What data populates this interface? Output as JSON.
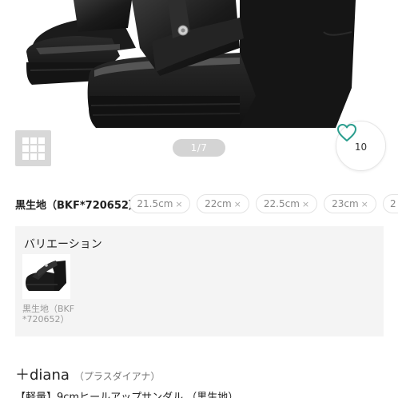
{
  "gallery": {
    "pager": "1/7",
    "favorite_count": "10"
  },
  "sizes": {
    "color_label": "黒生地（BKF*720652）",
    "options": [
      {
        "label": "21.5cm",
        "mark": "×"
      },
      {
        "label": "22cm",
        "mark": "×"
      },
      {
        "label": "22.5cm",
        "mark": "×"
      },
      {
        "label": "23cm",
        "mark": "×"
      },
      {
        "label": "2",
        "mark": ""
      }
    ]
  },
  "variation": {
    "heading": "バリエーション",
    "items": [
      {
        "caption": "黒生地（BKF*720652）"
      }
    ]
  },
  "product": {
    "brand": "＋diana",
    "brand_kana": "（プラスダイアナ）",
    "title": "【軽量】9cmヒールアップサンダル （黒生地）"
  },
  "icons": [
    "grid-icon",
    "heart-icon"
  ],
  "colors": {
    "accent": "#2b9e8e",
    "pager_bg": "#d4d4d4",
    "panel_bg": "#f4f4f4"
  }
}
